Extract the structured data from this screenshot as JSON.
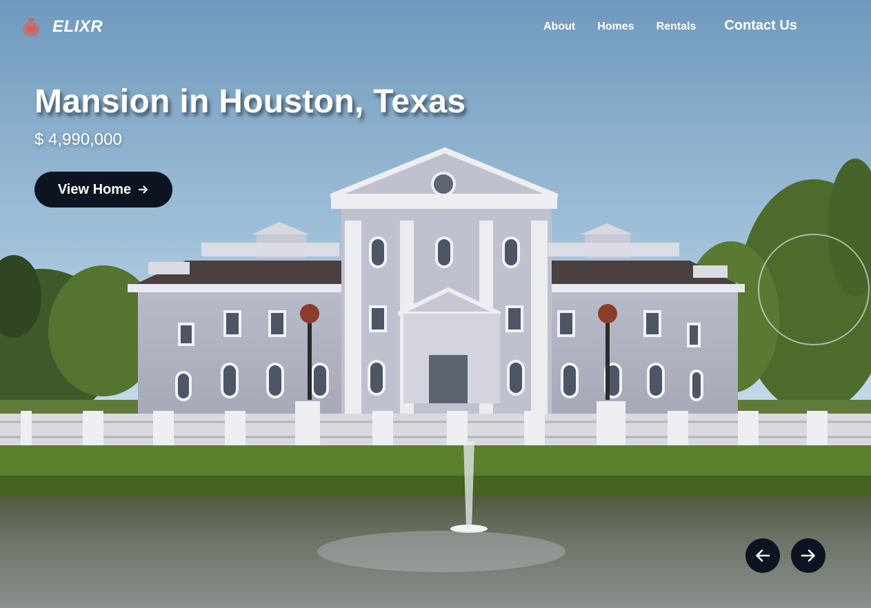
{
  "brand": {
    "name": "ELIXR",
    "icon": "potion-heart-icon",
    "icon_color": "#e0594f"
  },
  "nav": {
    "links": [
      "About",
      "Homes",
      "Rentals"
    ],
    "contact": "Contact Us"
  },
  "hero": {
    "title": "Mansion in Houston, Texas",
    "price": "$ 4,990,000",
    "cta_label": "View Home",
    "cta_icon": "arrow-right-icon",
    "prev_icon": "arrow-left-icon",
    "next_icon": "arrow-right-icon"
  },
  "colors": {
    "button_bg": "#0b1420",
    "text": "#ffffff"
  }
}
